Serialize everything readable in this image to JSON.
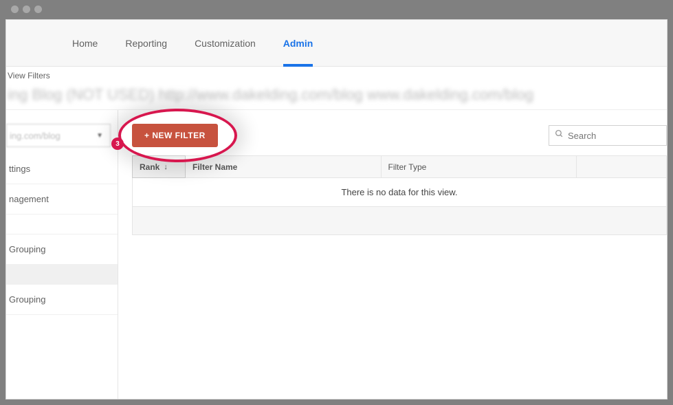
{
  "nav": {
    "items": [
      "Home",
      "Reporting",
      "Customization",
      "Admin"
    ],
    "active_index": 3
  },
  "subheader": {
    "small_label": "View Filters",
    "blurred_title": "ing Blog (NOT USED)   http://www.dakelding.com/blog   www.dakelding.com/blog"
  },
  "sidebar": {
    "dropdown_label": "ing.com/blog",
    "items": [
      {
        "label": "ttings"
      },
      {
        "label": "nagement"
      },
      {
        "label": ""
      },
      {
        "label": "Grouping"
      },
      {
        "label": "",
        "selected": true
      },
      {
        "label": "Grouping"
      }
    ]
  },
  "toolbar": {
    "new_filter_label": "+ NEW FILTER",
    "step_number": "3",
    "search_placeholder": "Search"
  },
  "table": {
    "columns": {
      "rank": "Rank",
      "name": "Filter Name",
      "type": "Filter Type"
    },
    "empty_message": "There is no data for this view."
  }
}
